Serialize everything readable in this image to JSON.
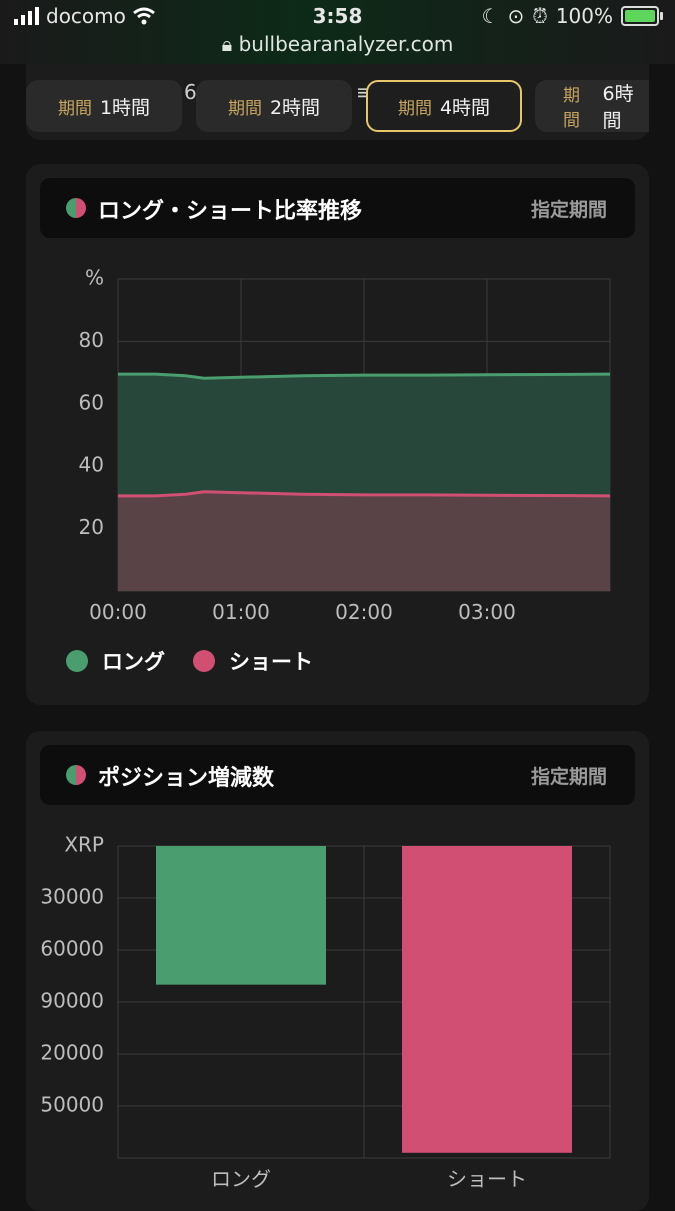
{
  "status_bar": {
    "carrier": "docomo",
    "time": "3:58",
    "url": "bullbearanalyzer.com",
    "battery": "100%"
  },
  "tabs": {
    "prefix": "期間",
    "items": [
      {
        "label": "1時間",
        "active": false
      },
      {
        "label": "2時間",
        "active": false
      },
      {
        "label": "4時間",
        "active": true
      },
      {
        "label": "6時間",
        "active": false
      }
    ],
    "ghost_text": "6"
  },
  "ratio_card": {
    "title": "ロング・ショート比率推移",
    "period_label": "指定期間",
    "legend": [
      {
        "label": "ロング",
        "color": "#4a9d6f"
      },
      {
        "label": "ショート",
        "color": "#d04f72"
      }
    ]
  },
  "position_card": {
    "title": "ポジション増減数",
    "period_label": "指定期間"
  },
  "chart_data": [
    {
      "type": "area",
      "unit_label": "%",
      "y_ticks": [
        "80",
        "60",
        "40",
        "20"
      ],
      "x_ticks": [
        "00:00",
        "01:00",
        "02:00",
        "03:00"
      ],
      "ylim": [
        0,
        100
      ],
      "series": [
        {
          "name": "ロング",
          "color": "#4a9d6f",
          "x": [
            0,
            0.3,
            0.55,
            0.7,
            1.0,
            1.5,
            2.0,
            2.5,
            3.0,
            3.5,
            4.0
          ],
          "values": [
            69.5,
            69.5,
            69.0,
            68.2,
            68.5,
            69.0,
            69.2,
            69.2,
            69.3,
            69.4,
            69.5
          ]
        },
        {
          "name": "ショート",
          "color": "#d04f72",
          "x": [
            0,
            0.3,
            0.55,
            0.7,
            1.0,
            1.5,
            2.0,
            2.5,
            3.0,
            3.5,
            4.0
          ],
          "values": [
            30.5,
            30.5,
            31.0,
            31.8,
            31.5,
            31.0,
            30.8,
            30.8,
            30.7,
            30.6,
            30.5
          ]
        }
      ],
      "grid": true
    },
    {
      "type": "bar",
      "unit_label": "XRP",
      "y_ticks": [
        "30000",
        "60000",
        "90000",
        "20000",
        "50000"
      ],
      "categories": [
        "ロング",
        "ショート"
      ],
      "values": [
        -80000,
        -177000
      ],
      "colors": [
        "#4a9d6f",
        "#d04f72"
      ],
      "ylim": [
        -180000,
        0
      ],
      "grid": true
    }
  ]
}
